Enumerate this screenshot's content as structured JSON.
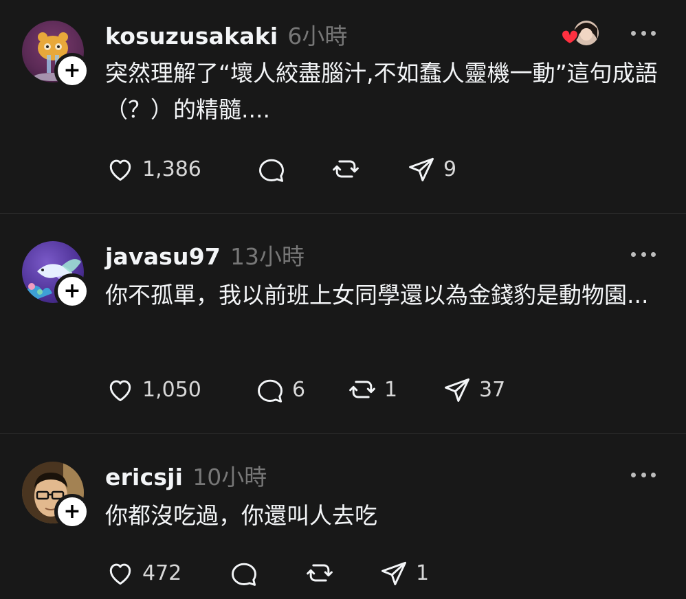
{
  "posts": [
    {
      "username": "kosuzusakaki",
      "time": "6小時",
      "text": "突然理解了“壞人絞盡腦汁,不如蠢人靈機一動”這句成語（？）的精髓....",
      "likes": "1,386",
      "replies": "",
      "reposts": "",
      "shares": "9",
      "avatar_icon": "cartoon-cat-avatar"
    },
    {
      "username": "javasu97",
      "time": "13小時",
      "text": "你不孤單，我以前班上女同學還以為金錢豹是動物園...",
      "likes": "1,050",
      "replies": "6",
      "reposts": "1",
      "shares": "37",
      "avatar_icon": "betta-fish-avatar"
    },
    {
      "username": "ericsji",
      "time": "10小時",
      "text": "你都沒吃過，你還叫人去吃",
      "likes": "472",
      "replies": "",
      "reposts": "",
      "shares": "1",
      "avatar_icon": "man-with-glasses-avatar"
    }
  ],
  "colors": {
    "background": "#181818",
    "divider": "#2e2e2e",
    "text": "#f3f5f7",
    "secondary": "#777777",
    "heart": "#ff3040"
  }
}
